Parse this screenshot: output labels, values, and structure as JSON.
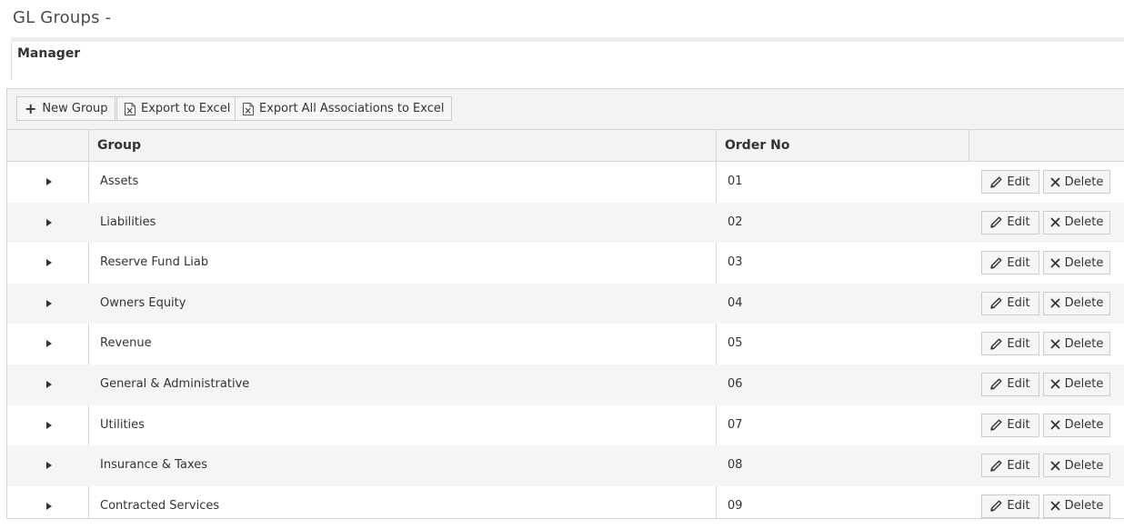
{
  "page": {
    "title": "GL Groups -",
    "manager_label": "Manager"
  },
  "toolbar": {
    "new_group_label": "New Group",
    "export_label": "Export to Excel",
    "export_all_label": "Export All Associations to Excel"
  },
  "table": {
    "columns": [
      "",
      "Group",
      "Order No",
      ""
    ],
    "rows": [
      {
        "group": "Assets",
        "order": "01"
      },
      {
        "group": "Liabilities",
        "order": "02"
      },
      {
        "group": "Reserve Fund Liab",
        "order": "03"
      },
      {
        "group": "Owners Equity",
        "order": "04"
      },
      {
        "group": "Revenue",
        "order": "05"
      },
      {
        "group": "General & Administrative",
        "order": "06"
      },
      {
        "group": "Utilities",
        "order": "07"
      },
      {
        "group": "Insurance & Taxes",
        "order": "08"
      },
      {
        "group": "Contracted Services",
        "order": "09"
      }
    ],
    "edit_label": "Edit",
    "delete_label": "Delete"
  },
  "icons": {
    "expand": "triangle-right-icon",
    "add": "plus-icon",
    "excel": "excel-file-icon",
    "edit": "pencil-icon",
    "delete": "close-icon"
  },
  "colors": {
    "toolbar_bg": "#f3f3f3",
    "alt_row_bg": "#f5f5f5",
    "border": "#d5d5d5"
  }
}
